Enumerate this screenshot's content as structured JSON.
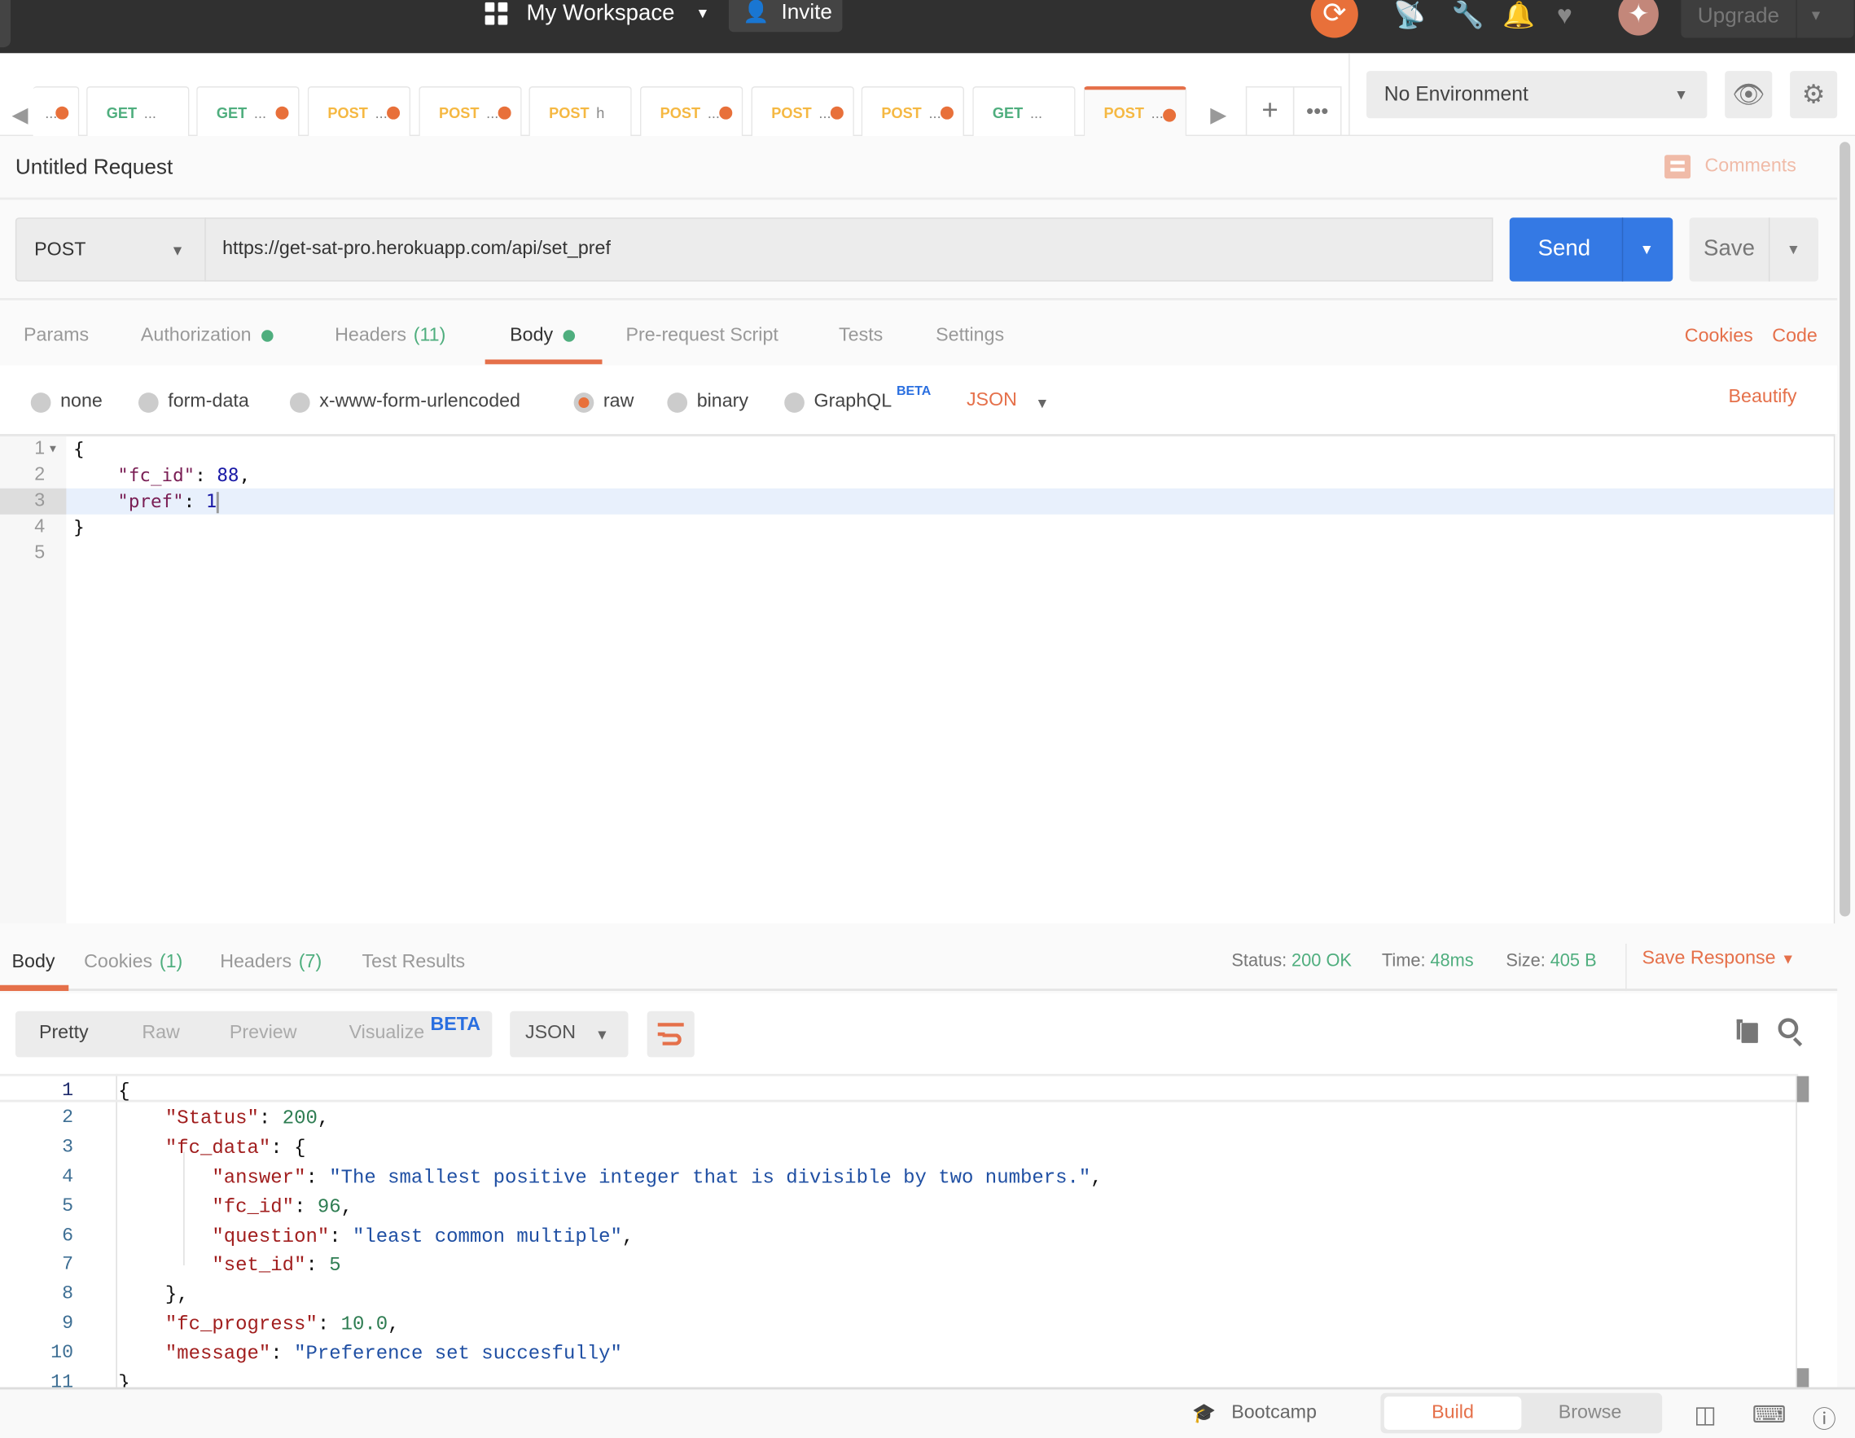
{
  "topbar": {
    "workspace_label": "My Workspace",
    "invite_label": "Invite",
    "upgrade_label": "Upgrade",
    "icons": [
      "workspace-grid-icon",
      "sync-icon",
      "satellite-icon",
      "wrench-icon",
      "bell-icon",
      "heart-icon",
      "avatar-sparkle-icon"
    ]
  },
  "tabs": [
    {
      "method": "",
      "label": "...",
      "unsaved": true
    },
    {
      "method": "GET",
      "label": "...",
      "unsaved": false
    },
    {
      "method": "GET",
      "label": "...",
      "unsaved": true
    },
    {
      "method": "POST",
      "label": "...",
      "unsaved": true
    },
    {
      "method": "POST",
      "label": "...",
      "unsaved": true
    },
    {
      "method": "POST",
      "label": "h",
      "unsaved": false
    },
    {
      "method": "POST",
      "label": "...",
      "unsaved": true
    },
    {
      "method": "POST",
      "label": "...",
      "unsaved": true
    },
    {
      "method": "POST",
      "label": "...",
      "unsaved": true
    },
    {
      "method": "GET",
      "label": "...",
      "unsaved": false
    },
    {
      "method": "POST",
      "label": "...",
      "unsaved": true,
      "active": true
    }
  ],
  "environment": {
    "selected": "No Environment"
  },
  "request": {
    "title": "Untitled Request",
    "comments_label": "Comments",
    "method": "POST",
    "url": "https://get-sat-pro.herokuapp.com/api/set_pref",
    "send_label": "Send",
    "save_label": "Save",
    "tabs": [
      {
        "label": "Params"
      },
      {
        "label": "Authorization",
        "dot": true
      },
      {
        "label": "Headers",
        "count": "(11)"
      },
      {
        "label": "Body",
        "dot": true,
        "active": true
      },
      {
        "label": "Pre-request Script"
      },
      {
        "label": "Tests"
      },
      {
        "label": "Settings"
      }
    ],
    "cookies_label": "Cookies",
    "code_label": "Code",
    "body_types": [
      {
        "label": "none"
      },
      {
        "label": "form-data"
      },
      {
        "label": "x-www-form-urlencoded"
      },
      {
        "label": "raw",
        "selected": true
      },
      {
        "label": "binary"
      },
      {
        "label": "GraphQL",
        "badge": "BETA"
      }
    ],
    "format": "JSON",
    "beautify_label": "Beautify",
    "body_lines": [
      [
        {
          "t": "punc",
          "v": "{"
        }
      ],
      [
        {
          "t": "punc",
          "v": "    "
        },
        {
          "t": "key",
          "v": "\"fc_id\""
        },
        {
          "t": "punc",
          "v": ": "
        },
        {
          "t": "num",
          "v": "88"
        },
        {
          "t": "punc",
          "v": ","
        }
      ],
      [
        {
          "t": "punc",
          "v": "    "
        },
        {
          "t": "key",
          "v": "\"pref\""
        },
        {
          "t": "punc",
          "v": ": "
        },
        {
          "t": "num",
          "v": "1"
        }
      ],
      [
        {
          "t": "punc",
          "v": "}"
        }
      ],
      []
    ]
  },
  "response": {
    "tabs": [
      {
        "label": "Body",
        "active": true
      },
      {
        "label": "Cookies",
        "count": "(1)"
      },
      {
        "label": "Headers",
        "count": "(7)"
      },
      {
        "label": "Test Results"
      }
    ],
    "status_label": "Status:",
    "status": "200 OK",
    "time_label": "Time:",
    "time": "48ms",
    "size_label": "Size:",
    "size": "405 B",
    "save_response_label": "Save Response",
    "views": [
      {
        "label": "Pretty",
        "active": true
      },
      {
        "label": "Raw"
      },
      {
        "label": "Preview"
      },
      {
        "label": "Visualize",
        "badge": "BETA"
      }
    ],
    "format": "JSON",
    "lines": [
      [
        {
          "t": "punc",
          "v": "{"
        }
      ],
      [
        {
          "t": "punc",
          "v": "    "
        },
        {
          "t": "key",
          "v": "\"Status\""
        },
        {
          "t": "punc",
          "v": ": "
        },
        {
          "t": "num",
          "v": "200"
        },
        {
          "t": "punc",
          "v": ","
        }
      ],
      [
        {
          "t": "punc",
          "v": "    "
        },
        {
          "t": "key",
          "v": "\"fc_data\""
        },
        {
          "t": "punc",
          "v": ": {"
        }
      ],
      [
        {
          "t": "punc",
          "v": "        "
        },
        {
          "t": "key",
          "v": "\"answer\""
        },
        {
          "t": "punc",
          "v": ": "
        },
        {
          "t": "str",
          "v": "\"The smallest positive integer that is divisible by two numbers.\""
        },
        {
          "t": "punc",
          "v": ","
        }
      ],
      [
        {
          "t": "punc",
          "v": "        "
        },
        {
          "t": "key",
          "v": "\"fc_id\""
        },
        {
          "t": "punc",
          "v": ": "
        },
        {
          "t": "num",
          "v": "96"
        },
        {
          "t": "punc",
          "v": ","
        }
      ],
      [
        {
          "t": "punc",
          "v": "        "
        },
        {
          "t": "key",
          "v": "\"question\""
        },
        {
          "t": "punc",
          "v": ": "
        },
        {
          "t": "str",
          "v": "\"least common multiple\""
        },
        {
          "t": "punc",
          "v": ","
        }
      ],
      [
        {
          "t": "punc",
          "v": "        "
        },
        {
          "t": "key",
          "v": "\"set_id\""
        },
        {
          "t": "punc",
          "v": ": "
        },
        {
          "t": "num",
          "v": "5"
        }
      ],
      [
        {
          "t": "punc",
          "v": "    },"
        }
      ],
      [
        {
          "t": "punc",
          "v": "    "
        },
        {
          "t": "key",
          "v": "\"fc_progress\""
        },
        {
          "t": "punc",
          "v": ": "
        },
        {
          "t": "num",
          "v": "10.0"
        },
        {
          "t": "punc",
          "v": ","
        }
      ],
      [
        {
          "t": "punc",
          "v": "    "
        },
        {
          "t": "key",
          "v": "\"message\""
        },
        {
          "t": "punc",
          "v": ": "
        },
        {
          "t": "str",
          "v": "\"Preference set succesfully\""
        }
      ],
      [
        {
          "t": "punc",
          "v": "}"
        }
      ]
    ]
  },
  "bottombar": {
    "bootcamp_label": "Bootcamp",
    "build_label": "Build",
    "browse_label": "Browse",
    "active_mode": "Build"
  },
  "colors": {
    "accent": "#e5704a",
    "send": "#3479e4",
    "success": "#4fae7e",
    "get": "#4fae7e",
    "post": "#f5b842"
  }
}
